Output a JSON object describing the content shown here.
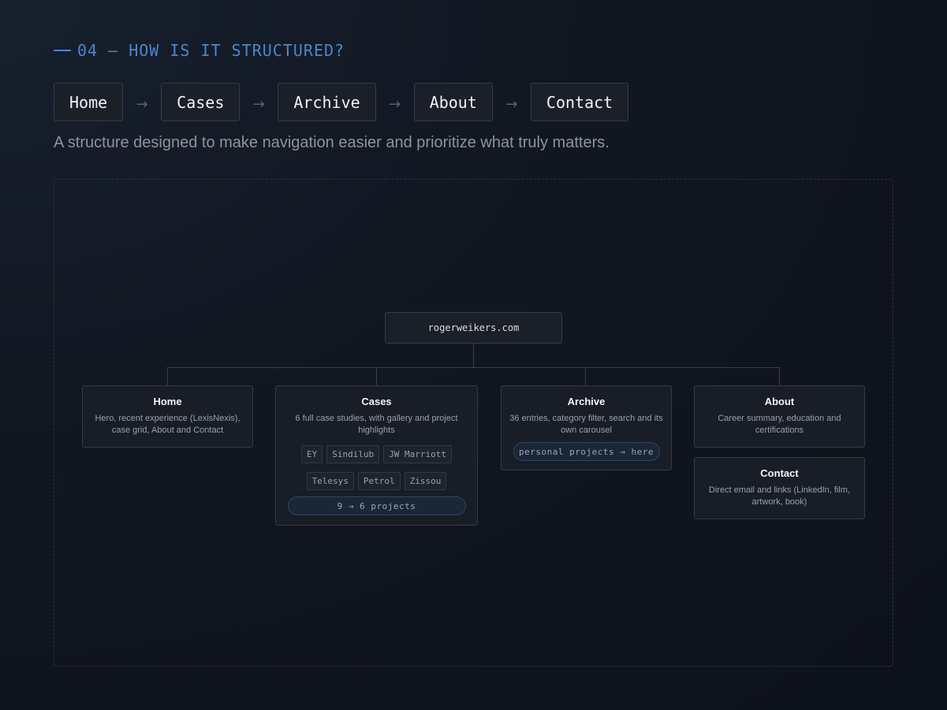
{
  "section": {
    "eyebrow": "04 — HOW IS IT STRUCTURED?",
    "subtitle": "A structure designed to make navigation easier and prioritize what truly matters."
  },
  "nav_flow": {
    "items": [
      "Home",
      "Cases",
      "Archive",
      "About",
      "Contact"
    ],
    "separator": "→"
  },
  "sitemap": {
    "root": "rogerweikers.com",
    "home": {
      "title": "Home",
      "desc": "Hero, recent experience (LexisNexis), case grid, About and Contact"
    },
    "cases": {
      "title": "Cases",
      "desc": "6 full case studies, with gallery and project highlights",
      "tags": [
        "EY",
        "Sindilub",
        "JW Marriott",
        "Telesys",
        "Petrol",
        "Zissou"
      ],
      "pill": "9 → 6 projects"
    },
    "archive": {
      "title": "Archive",
      "desc": "36 entries, category filter, search and its own carousel",
      "pill": "personal projects → here"
    },
    "about": {
      "title": "About",
      "desc": "Career summary, education and certifications"
    },
    "contact": {
      "title": "Contact",
      "desc": "Direct email and links (LinkedIn, film, artwork, book)"
    }
  },
  "colors": {
    "accent": "#4f86c9",
    "background": "#111620",
    "card": "#181d26",
    "border": "#343a46"
  }
}
